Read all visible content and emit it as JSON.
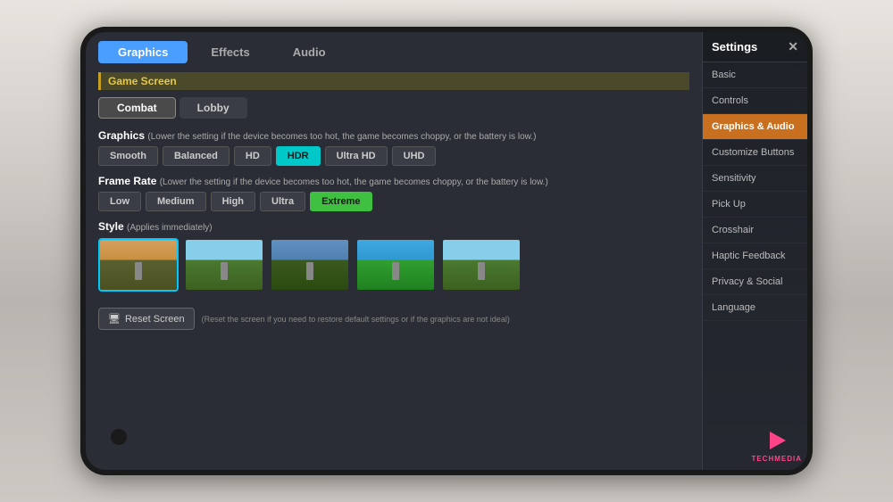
{
  "background": {
    "color": "#d0ccc8"
  },
  "phone": {
    "tabs": {
      "top": [
        {
          "label": "Graphics",
          "active": true,
          "key": "graphics"
        },
        {
          "label": "Effects",
          "active": false,
          "key": "effects"
        },
        {
          "label": "Audio",
          "active": false,
          "key": "audio"
        }
      ],
      "sub": [
        {
          "label": "Combat",
          "active": true,
          "key": "combat"
        },
        {
          "label": "Lobby",
          "active": false,
          "key": "lobby"
        }
      ]
    },
    "section_label": "Game Screen",
    "graphics": {
      "title": "Graphics",
      "note": "(Lower the setting if the device becomes too hot, the game becomes choppy, or the battery is low.)",
      "options": [
        "Smooth",
        "Balanced",
        "HD",
        "HDR",
        "Ultra HD",
        "UHD"
      ],
      "selected": "HDR"
    },
    "framerate": {
      "title": "Frame Rate",
      "note": "(Lower the setting if the device becomes too hot, the game becomes choppy, or the battery is low.)",
      "options": [
        "Low",
        "Medium",
        "High",
        "Ultra",
        "Extreme"
      ],
      "selected": "Extreme"
    },
    "style": {
      "title": "Style",
      "note": "(Applies immediately)",
      "thumbnails": [
        "default",
        "warm",
        "cool",
        "vivid",
        "default2"
      ],
      "selected": 0
    },
    "reset": {
      "button_label": "Reset Screen",
      "note": "(Reset the screen if you need to restore default settings or if the graphics are not ideal)"
    }
  },
  "sidebar": {
    "title": "Settings",
    "close_label": "✕",
    "items": [
      {
        "label": "Basic",
        "active": false,
        "key": "basic"
      },
      {
        "label": "Controls",
        "active": false,
        "key": "controls"
      },
      {
        "label": "Graphics & Audio",
        "active": true,
        "key": "graphics-audio"
      },
      {
        "label": "Customize Buttons",
        "active": false,
        "key": "customize"
      },
      {
        "label": "Sensitivity",
        "active": false,
        "key": "sensitivity"
      },
      {
        "label": "Pick Up",
        "active": false,
        "key": "pickup"
      },
      {
        "label": "Crosshair",
        "active": false,
        "key": "crosshair"
      },
      {
        "label": "Haptic Feedback",
        "active": false,
        "key": "haptic"
      },
      {
        "label": "Privacy & Social",
        "active": false,
        "key": "privacy"
      },
      {
        "label": "Language",
        "active": false,
        "key": "language"
      }
    ]
  },
  "watermark": {
    "text": "TECHMEDIA"
  }
}
